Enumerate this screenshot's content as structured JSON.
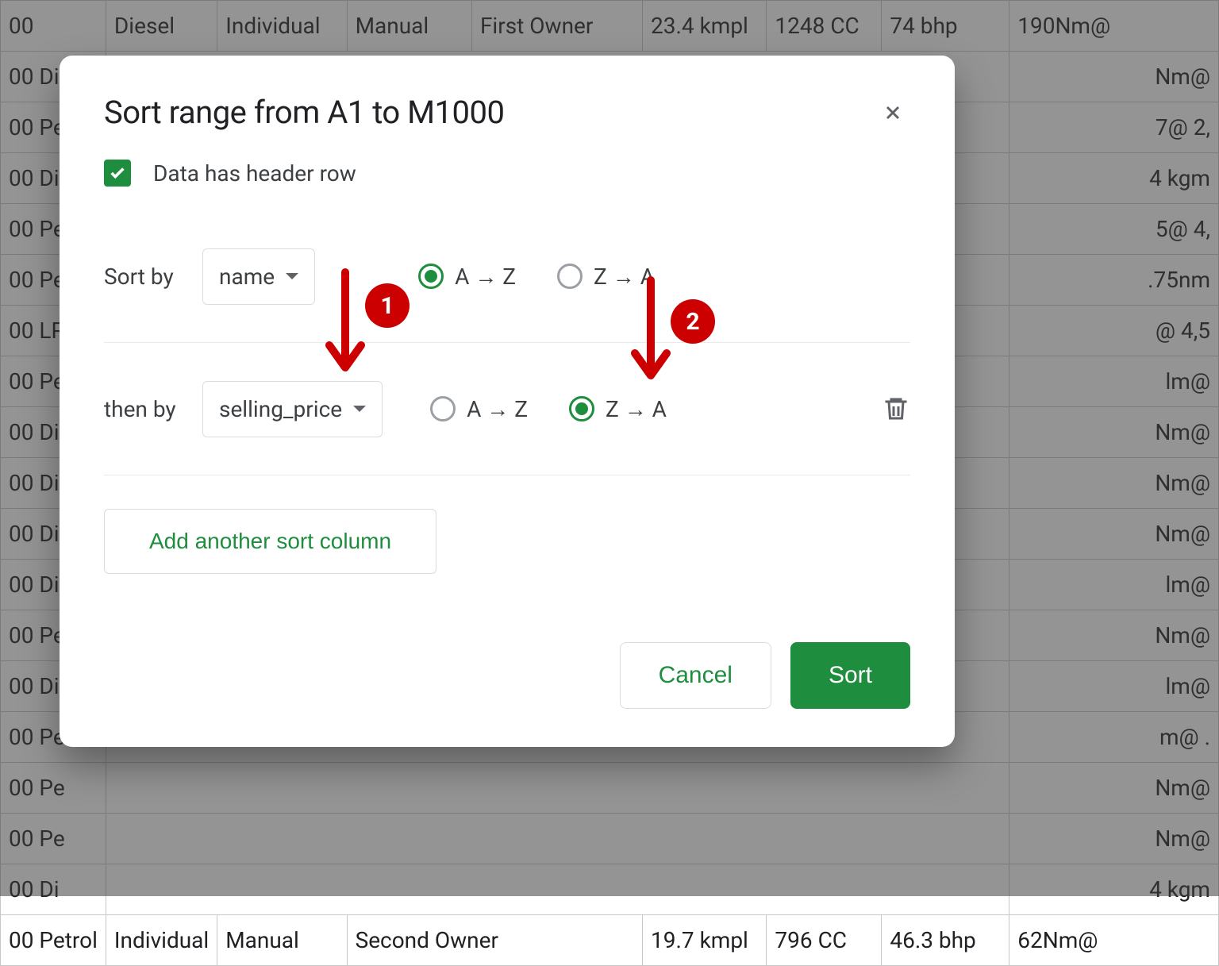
{
  "background_table": {
    "columns_sample": [
      "00",
      "Diesel",
      "Individual",
      "Manual",
      "First Owner",
      "23.4 kmpl",
      "1248 CC",
      "74 bhp",
      "190Nm@"
    ],
    "rows_left_col": [
      "00 Di",
      "00 Pe",
      "00 Di",
      "00 Pe",
      "00 Pe",
      "00 LP",
      "00 Pe",
      "00 Di",
      "00 Di",
      "00 Di",
      "00 Di",
      "00 Pe",
      "00 Di",
      "00 Pe",
      "00 Pe",
      "00 Pe",
      "00 Di",
      "00 Di"
    ],
    "last_row": [
      "00 Petrol",
      "Individual",
      "Manual",
      "Second Owner",
      "19.7 kmpl",
      "796 CC",
      "46.3 bhp",
      "62Nm@"
    ],
    "right_fragments": [
      "Nm@",
      "7@ 2,",
      "4 kgm",
      "5@ 4,",
      ".75nm",
      "@ 4,5",
      "lm@",
      "Nm@",
      "Nm@",
      "Nm@",
      "lm@",
      "Nm@",
      "lm@",
      "m@ .",
      "Nm@",
      "Nm@",
      "4 kgm"
    ]
  },
  "dialog": {
    "title": "Sort range from A1 to M1000",
    "header_checkbox_label": "Data has header row",
    "header_checkbox_checked": true,
    "sort_by_label": "Sort by",
    "then_by_label": "then by",
    "rows": [
      {
        "column": "name",
        "asc_label": "A → Z",
        "desc_label": "Z → A",
        "asc_selected": true,
        "deletable": false
      },
      {
        "column": "selling_price",
        "asc_label": "A → Z",
        "desc_label": "Z → A",
        "asc_selected": false,
        "deletable": true
      }
    ],
    "add_button": "Add another sort column",
    "cancel": "Cancel",
    "sort": "Sort"
  },
  "annotations": [
    {
      "badge": "1"
    },
    {
      "badge": "2"
    }
  ]
}
